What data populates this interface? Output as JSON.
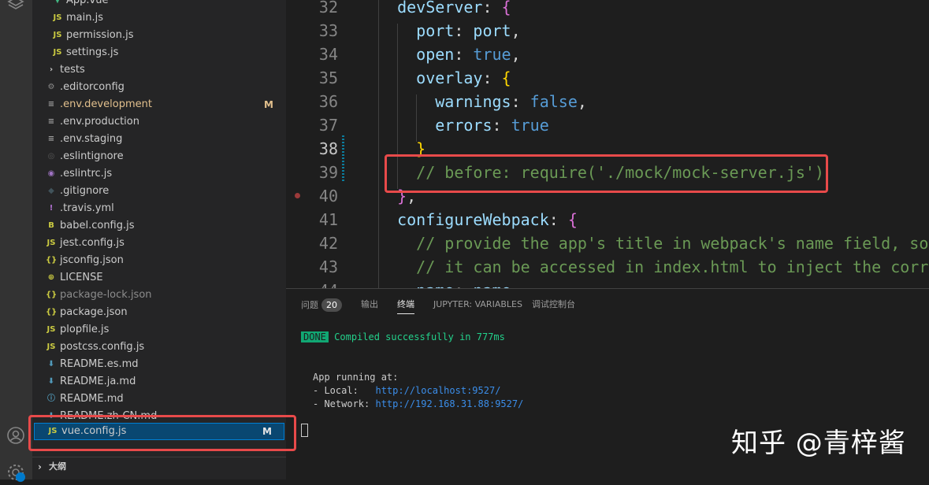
{
  "explorer": {
    "items": [
      {
        "label": "App.vue",
        "icon": "vue-icon",
        "icon_text": "▼",
        "color": "#41b883",
        "indent": 2
      },
      {
        "label": "main.js",
        "icon": "js-file-icon",
        "icon_text": "JS",
        "color": "#cbcb41",
        "indent": 2
      },
      {
        "label": "permission.js",
        "icon": "js-file-icon",
        "icon_text": "JS",
        "color": "#cbcb41",
        "indent": 2
      },
      {
        "label": "settings.js",
        "icon": "js-file-icon",
        "icon_text": "JS",
        "color": "#cbcb41",
        "indent": 2
      },
      {
        "label": "tests",
        "icon": "chevron-right-icon",
        "icon_text": "›",
        "color": "#cccccc",
        "indent": 1
      },
      {
        "label": ".editorconfig",
        "icon": "gear-icon",
        "icon_text": "⚙",
        "color": "#8c8c8c",
        "indent": 1
      },
      {
        "label": ".env.development",
        "icon": "lines-icon",
        "icon_text": "≡",
        "color": "#a0a0a0",
        "indent": 1,
        "badge": "M",
        "modified": true
      },
      {
        "label": ".env.production",
        "icon": "lines-icon",
        "icon_text": "≡",
        "color": "#a0a0a0",
        "indent": 1
      },
      {
        "label": ".env.staging",
        "icon": "lines-icon",
        "icon_text": "≡",
        "color": "#a0a0a0",
        "indent": 1
      },
      {
        "label": ".eslintignore",
        "icon": "eslint-icon",
        "icon_text": "◎",
        "color": "#5a5a5a",
        "indent": 1
      },
      {
        "label": ".eslintrc.js",
        "icon": "eslint-icon",
        "icon_text": "◉",
        "color": "#a074c4",
        "indent": 1
      },
      {
        "label": ".gitignore",
        "icon": "git-icon",
        "icon_text": "◆",
        "color": "#41535b",
        "indent": 1
      },
      {
        "label": ".travis.yml",
        "icon": "exclamation-icon",
        "icon_text": "!",
        "color": "#b070d0",
        "indent": 1
      },
      {
        "label": "babel.config.js",
        "icon": "babel-icon",
        "icon_text": "B",
        "color": "#cbcb41",
        "indent": 1
      },
      {
        "label": "jest.config.js",
        "icon": "js-file-icon",
        "icon_text": "JS",
        "color": "#cbcb41",
        "indent": 1
      },
      {
        "label": "jsconfig.json",
        "icon": "json-icon",
        "icon_text": "{}",
        "color": "#cbcb41",
        "indent": 1
      },
      {
        "label": "LICENSE",
        "icon": "license-icon",
        "icon_text": "⊕",
        "color": "#cbcb41",
        "indent": 1
      },
      {
        "label": "package-lock.json",
        "icon": "json-icon",
        "icon_text": "{}",
        "color": "#cbcb41",
        "indent": 1,
        "dim": true
      },
      {
        "label": "package.json",
        "icon": "json-icon",
        "icon_text": "{}",
        "color": "#cbcb41",
        "indent": 1
      },
      {
        "label": "plopfile.js",
        "icon": "js-file-icon",
        "icon_text": "JS",
        "color": "#cbcb41",
        "indent": 1
      },
      {
        "label": "postcss.config.js",
        "icon": "js-file-icon",
        "icon_text": "JS",
        "color": "#cbcb41",
        "indent": 1
      },
      {
        "label": "README.es.md",
        "icon": "download-icon",
        "icon_text": "⬇",
        "color": "#519aba",
        "indent": 1
      },
      {
        "label": "README.ja.md",
        "icon": "download-icon",
        "icon_text": "⬇",
        "color": "#519aba",
        "indent": 1
      },
      {
        "label": "README.md",
        "icon": "info-icon",
        "icon_text": "ⓘ",
        "color": "#519aba",
        "indent": 1
      },
      {
        "label": "README.zh-CN.md",
        "icon": "download-icon",
        "icon_text": "⬇",
        "color": "#519aba",
        "indent": 1
      },
      {
        "label": "vue.config.js",
        "icon": "js-file-icon",
        "icon_text": "JS",
        "color": "#cbcb41",
        "indent": 1,
        "badge": "M",
        "selected": true
      }
    ],
    "outline_label": "大纲"
  },
  "editor": {
    "active_line": 38,
    "lines": [
      {
        "num": "32",
        "tokens": [
          {
            "t": "  devServer",
            "c": "#9cdcfe"
          },
          {
            "t": ": ",
            "c": "#d4d4d4"
          },
          {
            "t": "{",
            "c": "#da70d6"
          }
        ]
      },
      {
        "num": "33",
        "tokens": [
          {
            "t": "    port",
            "c": "#9cdcfe"
          },
          {
            "t": ": ",
            "c": "#d4d4d4"
          },
          {
            "t": "port",
            "c": "#9cdcfe"
          },
          {
            "t": ",",
            "c": "#d4d4d4"
          }
        ]
      },
      {
        "num": "34",
        "tokens": [
          {
            "t": "    open",
            "c": "#9cdcfe"
          },
          {
            "t": ": ",
            "c": "#d4d4d4"
          },
          {
            "t": "true",
            "c": "#569cd6"
          },
          {
            "t": ",",
            "c": "#d4d4d4"
          }
        ]
      },
      {
        "num": "35",
        "tokens": [
          {
            "t": "    overlay",
            "c": "#9cdcfe"
          },
          {
            "t": ": ",
            "c": "#d4d4d4"
          },
          {
            "t": "{",
            "c": "#ffd700"
          }
        ]
      },
      {
        "num": "36",
        "tokens": [
          {
            "t": "      warnings",
            "c": "#9cdcfe"
          },
          {
            "t": ": ",
            "c": "#d4d4d4"
          },
          {
            "t": "false",
            "c": "#569cd6"
          },
          {
            "t": ",",
            "c": "#d4d4d4"
          }
        ]
      },
      {
        "num": "37",
        "tokens": [
          {
            "t": "      errors",
            "c": "#9cdcfe"
          },
          {
            "t": ": ",
            "c": "#d4d4d4"
          },
          {
            "t": "true",
            "c": "#569cd6"
          }
        ]
      },
      {
        "num": "38",
        "tokens": [
          {
            "t": "    }",
            "c": "#ffd700"
          }
        ]
      },
      {
        "num": "39",
        "tokens": [
          {
            "t": "    // before: require(",
            "c": "#6a9955"
          },
          {
            "t": "'./mock/mock-server.js'",
            "c": "#6a9955"
          },
          {
            "t": ")",
            "c": "#6a9955"
          }
        ]
      },
      {
        "num": "40",
        "tokens": [
          {
            "t": "  }",
            "c": "#da70d6"
          },
          {
            "t": ",",
            "c": "#d4d4d4"
          }
        ]
      },
      {
        "num": "41",
        "tokens": [
          {
            "t": "  configureWebpack",
            "c": "#9cdcfe"
          },
          {
            "t": ": ",
            "c": "#d4d4d4"
          },
          {
            "t": "{",
            "c": "#da70d6"
          }
        ]
      },
      {
        "num": "42",
        "tokens": [
          {
            "t": "    // provide the app's title in webpack's name field, so that",
            "c": "#6a9955"
          }
        ]
      },
      {
        "num": "43",
        "tokens": [
          {
            "t": "    // it can be accessed in index.html to inject the correct title.",
            "c": "#6a9955"
          }
        ]
      },
      {
        "num": "44",
        "tokens": [
          {
            "t": "    name",
            "c": "#9cdcfe"
          },
          {
            "t": ": ",
            "c": "#d4d4d4"
          },
          {
            "t": "name",
            "c": "#9cdcfe"
          },
          {
            "t": ",",
            "c": "#d4d4d4"
          }
        ]
      }
    ]
  },
  "panel": {
    "tabs": [
      {
        "label": "问题",
        "badge": "20"
      },
      {
        "label": "输出"
      },
      {
        "label": "终端",
        "active": true
      },
      {
        "label": "JUPYTER: VARIABLES"
      },
      {
        "label": "调试控制台"
      }
    ],
    "terminal": {
      "done_label": "DONE",
      "compiled_text": "Compiled successfully in 777ms",
      "running_label": "App running at:",
      "local_label": "- Local:   ",
      "local_url": "http://localhost:9527/",
      "network_label": "- Network: ",
      "network_url": "http://192.168.31.88:9527/"
    }
  },
  "watermark": "知乎 @青梓酱",
  "colors": {
    "highlight_box": "#e84a4a",
    "selection": "#094771",
    "modified": "#e2c08d"
  }
}
